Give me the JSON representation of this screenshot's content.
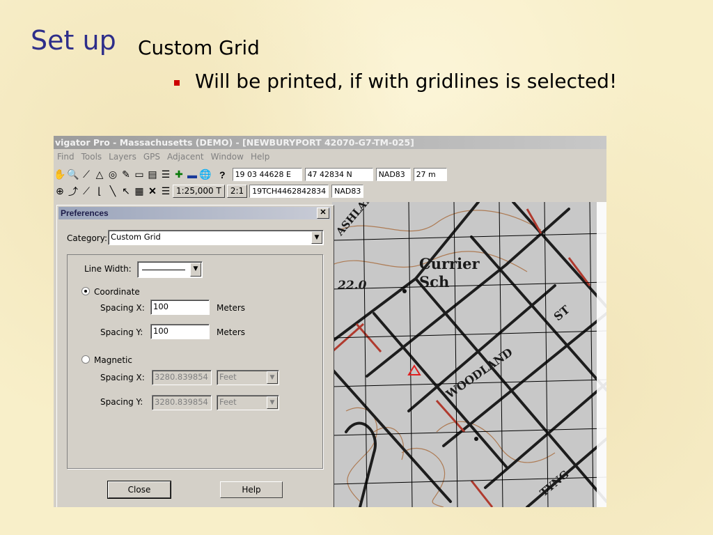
{
  "slide": {
    "title": "Set up",
    "subtitle": "Custom Grid",
    "bullet": "Will be printed, if with gridlines is selected!"
  },
  "app": {
    "window_title": "vigator Pro - Massachusetts (DEMO) - [NEWBURYPORT 42070-G7-TM-025]",
    "menu": [
      "Find",
      "Tools",
      "Layers",
      "GPS",
      "Adjacent",
      "Window",
      "Help"
    ],
    "toolbar1": {
      "help_glyph": "?",
      "easting": "19 03 44628 E",
      "northing": "47 42834 N",
      "datum": "NAD83",
      "elevation": "27 m"
    },
    "toolbar2": {
      "scale": "1:25,000 T",
      "ratio": "2:1",
      "grid_ref": "19TCH4462842834",
      "datum": "NAD83"
    }
  },
  "map": {
    "labels": [
      "ASHLAND",
      "Currier",
      "Sch",
      "22.0",
      "WOODLAND",
      "ST",
      "TYNG"
    ]
  },
  "dialog": {
    "title": "Preferences",
    "close_glyph": "✕",
    "category_label": "Category:",
    "category_value": "Custom Grid",
    "line_width_label": "Line Width:",
    "coordinate_label": "Coordinate",
    "coordinate_selected": true,
    "spacing_x_label": "Spacing X:",
    "spacing_y_label": "Spacing Y:",
    "coord_x": "100",
    "coord_y": "100",
    "coord_unit_x": "Meters",
    "coord_unit_y": "Meters",
    "magnetic_label": "Magnetic",
    "mag_x": "3280.839854",
    "mag_y": "3280.839854",
    "mag_unit_x": "Feet",
    "mag_unit_y": "Feet",
    "close_button": "Close",
    "help_button": "Help"
  },
  "icons": {
    "dropdown": "▼"
  }
}
